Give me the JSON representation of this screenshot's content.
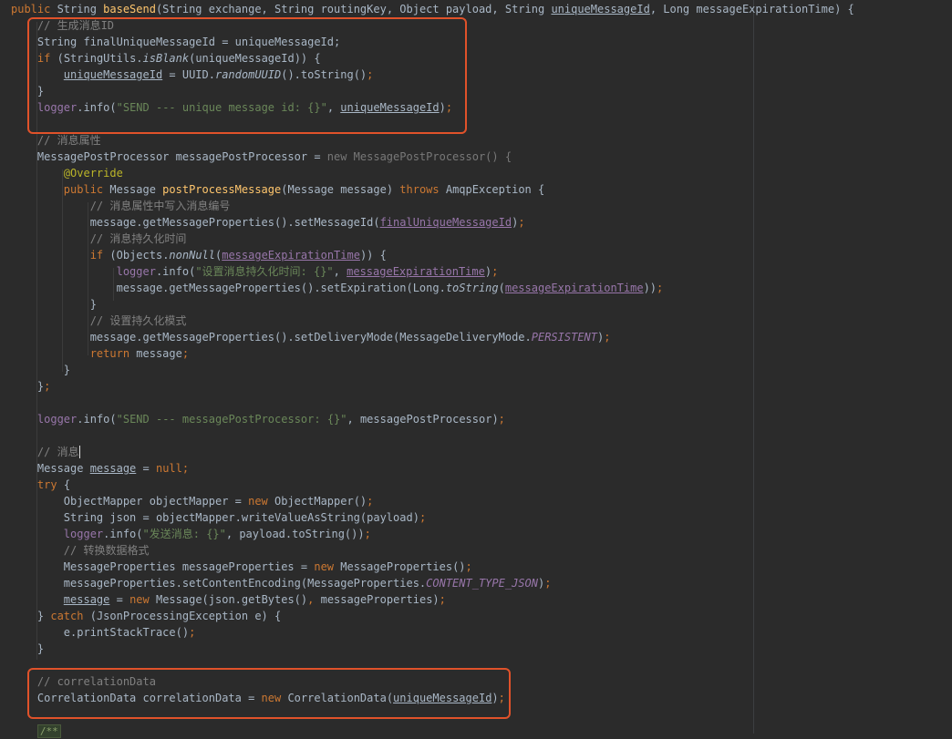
{
  "editor": {
    "theme": "darcula",
    "highlight_color": "#e0522a",
    "lines": [
      [
        {
          "t": "public ",
          "k": "kw"
        },
        {
          "t": "String "
        },
        {
          "t": "baseSend",
          "k": "fn"
        },
        {
          "t": "(String exchange, String routingKey, Object payload, String "
        },
        {
          "t": "uniqueMessageId",
          "k": "ul"
        },
        {
          "t": ", Long messageExpirationTime) {"
        }
      ],
      [
        {
          "t": "    // 生成消息ID",
          "k": "cm"
        }
      ],
      [
        {
          "t": "    String finalUniqueMessageId = uniqueMessageId;"
        }
      ],
      [
        {
          "t": "    "
        },
        {
          "t": "if ",
          "k": "kw"
        },
        {
          "t": "(StringUtils."
        },
        {
          "t": "isBlank",
          "k": "it"
        },
        {
          "t": "(uniqueMessageId)) {"
        }
      ],
      [
        {
          "t": "        "
        },
        {
          "t": "uniqueMessageId",
          "k": "ul"
        },
        {
          "t": " = UUID."
        },
        {
          "t": "randomUUID",
          "k": "it"
        },
        {
          "t": "().toString()"
        },
        {
          "t": ";",
          "k": "kw"
        }
      ],
      [
        {
          "t": "    }"
        }
      ],
      [
        {
          "t": "    "
        },
        {
          "t": "logger",
          "k": "fld"
        },
        {
          "t": ".info("
        },
        {
          "t": "\"SEND --- unique message id: {}\"",
          "k": "str"
        },
        {
          "t": ", "
        },
        {
          "t": "uniqueMessageId",
          "k": "ul"
        },
        {
          "t": ")"
        },
        {
          "t": ";",
          "k": "kw"
        }
      ],
      [],
      [
        {
          "t": "    // 消息属性",
          "k": "cm"
        }
      ],
      [
        {
          "t": "    MessagePostProcessor messagePostProcessor = "
        },
        {
          "t": "new MessagePostProcessor() {",
          "k": "dim"
        }
      ],
      [
        {
          "t": "        "
        },
        {
          "t": "@Override",
          "k": "ann"
        }
      ],
      [
        {
          "t": "        "
        },
        {
          "t": "public ",
          "k": "kw"
        },
        {
          "t": "Message "
        },
        {
          "t": "postProcessMessage",
          "k": "fn"
        },
        {
          "t": "(Message message) "
        },
        {
          "t": "throws ",
          "k": "kw"
        },
        {
          "t": "AmqpException {"
        }
      ],
      [
        {
          "t": "            // 消息属性中写入消息编号",
          "k": "cm"
        }
      ],
      [
        {
          "t": "            message.getMessageProperties().setMessageId("
        },
        {
          "t": "finalUniqueMessageId",
          "k": "fldul"
        },
        {
          "t": ")"
        },
        {
          "t": ";",
          "k": "kw"
        }
      ],
      [
        {
          "t": "            // 消息持久化时间",
          "k": "cm"
        }
      ],
      [
        {
          "t": "            "
        },
        {
          "t": "if ",
          "k": "kw"
        },
        {
          "t": "(Objects."
        },
        {
          "t": "nonNull",
          "k": "it"
        },
        {
          "t": "("
        },
        {
          "t": "messageExpirationTime",
          "k": "fldul"
        },
        {
          "t": ")) {"
        }
      ],
      [
        {
          "t": "                "
        },
        {
          "t": "logger",
          "k": "fld"
        },
        {
          "t": ".info("
        },
        {
          "t": "\"设置消息持久化时间: {}\"",
          "k": "str"
        },
        {
          "t": ", "
        },
        {
          "t": "messageExpirationTime",
          "k": "fldul"
        },
        {
          "t": ")"
        },
        {
          "t": ";",
          "k": "kw"
        }
      ],
      [
        {
          "t": "                message.getMessageProperties().setExpiration(Long."
        },
        {
          "t": "toString",
          "k": "it"
        },
        {
          "t": "("
        },
        {
          "t": "messageExpirationTime",
          "k": "fldul"
        },
        {
          "t": "))"
        },
        {
          "t": ";",
          "k": "kw"
        }
      ],
      [
        {
          "t": "            }"
        }
      ],
      [
        {
          "t": "            // 设置持久化模式",
          "k": "cm"
        }
      ],
      [
        {
          "t": "            message.getMessageProperties().setDeliveryMode(MessageDeliveryMode."
        },
        {
          "t": "PERSISTENT",
          "k": "cst"
        },
        {
          "t": ")"
        },
        {
          "t": ";",
          "k": "kw"
        }
      ],
      [
        {
          "t": "            "
        },
        {
          "t": "return ",
          "k": "kw"
        },
        {
          "t": "message"
        },
        {
          "t": ";",
          "k": "kw"
        }
      ],
      [
        {
          "t": "        }"
        }
      ],
      [
        {
          "t": "    }"
        },
        {
          "t": ";",
          "k": "kw"
        }
      ],
      [],
      [
        {
          "t": "    "
        },
        {
          "t": "logger",
          "k": "fld"
        },
        {
          "t": ".info("
        },
        {
          "t": "\"SEND --- messagePostProcessor: {}\"",
          "k": "str"
        },
        {
          "t": ", messagePostProcessor)"
        },
        {
          "t": ";",
          "k": "kw"
        }
      ],
      [],
      [
        {
          "t": "    // 消息",
          "k": "cm"
        }
      ],
      [
        {
          "t": "    Message "
        },
        {
          "t": "message",
          "k": "ul"
        },
        {
          "t": " = "
        },
        {
          "t": "null",
          "k": "kw"
        },
        {
          "t": ";",
          "k": "kw"
        }
      ],
      [
        {
          "t": "    "
        },
        {
          "t": "try ",
          "k": "kw"
        },
        {
          "t": "{"
        }
      ],
      [
        {
          "t": "        ObjectMapper objectMapper = "
        },
        {
          "t": "new ",
          "k": "kw"
        },
        {
          "t": "ObjectMapper()"
        },
        {
          "t": ";",
          "k": "kw"
        }
      ],
      [
        {
          "t": "        String json = objectMapper.writeValueAsString(payload)"
        },
        {
          "t": ";",
          "k": "kw"
        }
      ],
      [
        {
          "t": "        "
        },
        {
          "t": "logger",
          "k": "fld"
        },
        {
          "t": ".info("
        },
        {
          "t": "\"发送消息: {}\"",
          "k": "str"
        },
        {
          "t": ", payload.toString())"
        },
        {
          "t": ";",
          "k": "kw"
        }
      ],
      [
        {
          "t": "        // 转换数据格式",
          "k": "cm"
        }
      ],
      [
        {
          "t": "        MessageProperties messageProperties = "
        },
        {
          "t": "new ",
          "k": "kw"
        },
        {
          "t": "MessageProperties()"
        },
        {
          "t": ";",
          "k": "kw"
        }
      ],
      [
        {
          "t": "        messageProperties.setContentEncoding(MessageProperties."
        },
        {
          "t": "CONTENT_TYPE_JSON",
          "k": "cst"
        },
        {
          "t": ")"
        },
        {
          "t": ";",
          "k": "kw"
        }
      ],
      [
        {
          "t": "        "
        },
        {
          "t": "message",
          "k": "ul"
        },
        {
          "t": " = "
        },
        {
          "t": "new ",
          "k": "kw"
        },
        {
          "t": "Message(json.getBytes()"
        },
        {
          "t": ", ",
          "k": "kw"
        },
        {
          "t": "messageProperties)"
        },
        {
          "t": ";",
          "k": "kw"
        }
      ],
      [
        {
          "t": "    } "
        },
        {
          "t": "catch ",
          "k": "kw"
        },
        {
          "t": "(JsonProcessingException e) {"
        }
      ],
      [
        {
          "t": "        e.printStackTrace()"
        },
        {
          "t": ";",
          "k": "kw"
        }
      ],
      [
        {
          "t": "    }"
        }
      ],
      [],
      [
        {
          "t": "    // correlationData",
          "k": "cm"
        }
      ],
      [
        {
          "t": "    CorrelationData correlationData = "
        },
        {
          "t": "new ",
          "k": "kw"
        },
        {
          "t": "CorrelationData("
        },
        {
          "t": "uniqueMessageId",
          "k": "ul"
        },
        {
          "t": ")"
        },
        {
          "t": ";",
          "k": "kw"
        }
      ],
      [],
      [
        {
          "t": "    "
        },
        {
          "t": "/**",
          "k": "fold"
        }
      ]
    ]
  }
}
